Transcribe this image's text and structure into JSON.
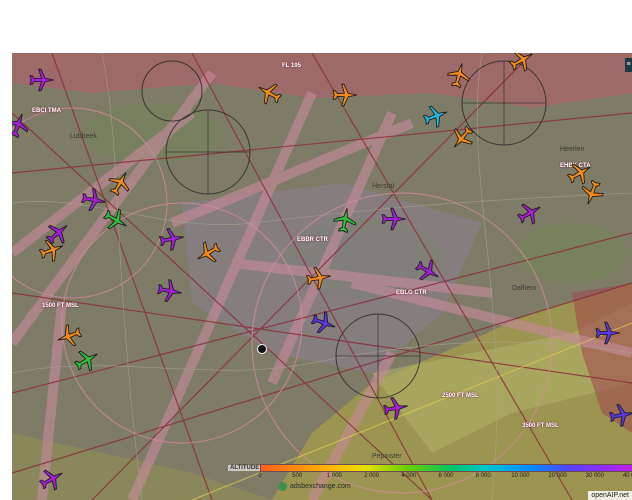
{
  "colors": {
    "land": "#7e7c67",
    "airspace_zone": "#b85a6c",
    "corridor": "#c88a9c",
    "warm_zone": "#a19a4e"
  },
  "map": {
    "cities": [
      "Lubbeek",
      "Heerlen",
      "Herstal",
      "Dalhem",
      "Pepinster"
    ],
    "airspace_labels": [
      "EBBR CTR",
      "EBLG CTR",
      "EHBK CTA",
      "EBCI TMA",
      "FL 195",
      "1500 FT MSL",
      "3500 FT MSL",
      "2500 FT MSL"
    ],
    "aircraft": [
      {
        "color": "purple",
        "heading": 90
      },
      {
        "color": "purple",
        "heading": 20
      },
      {
        "color": "orange",
        "heading": 300
      },
      {
        "color": "orange",
        "heading": 90
      },
      {
        "color": "cyan",
        "heading": 70
      },
      {
        "color": "orange",
        "heading": 15
      },
      {
        "color": "orange",
        "heading": 60
      },
      {
        "color": "orange",
        "heading": 220
      },
      {
        "color": "green",
        "heading": 120
      },
      {
        "color": "purple",
        "heading": 100
      },
      {
        "color": "orange",
        "heading": 30
      },
      {
        "color": "purple",
        "heading": 80
      },
      {
        "color": "purple",
        "heading": 50
      },
      {
        "color": "orange",
        "heading": 70
      },
      {
        "color": "green",
        "heading": 10
      },
      {
        "color": "orange",
        "heading": 240
      },
      {
        "color": "purple",
        "heading": 90
      },
      {
        "color": "purple",
        "heading": 120
      },
      {
        "color": "purple",
        "heading": 100
      },
      {
        "color": "orange",
        "heading": 80
      },
      {
        "color": "blue",
        "heading": 110
      },
      {
        "color": "orange",
        "heading": 250
      },
      {
        "color": "green",
        "heading": 60
      },
      {
        "color": "purple",
        "heading": 60
      },
      {
        "color": "blue",
        "heading": 90
      },
      {
        "color": "purple",
        "heading": 80
      },
      {
        "color": "blue",
        "heading": 80
      },
      {
        "color": "purple",
        "heading": 60
      },
      {
        "color": "orange",
        "heading": 60
      },
      {
        "color": "orange",
        "heading": 200
      }
    ]
  },
  "legend": {
    "title": "ALTITUDE (ft)",
    "ticks": [
      "0",
      "500",
      "1 000",
      "2 000",
      "4 000",
      "6 000",
      "8 000",
      "10 000",
      "20 000",
      "30 000",
      "40 000"
    ]
  },
  "credits": {
    "adsb": "adsbexchange.com",
    "openaip": "openAIP.net"
  },
  "corner_button": {
    "label": "≡"
  }
}
